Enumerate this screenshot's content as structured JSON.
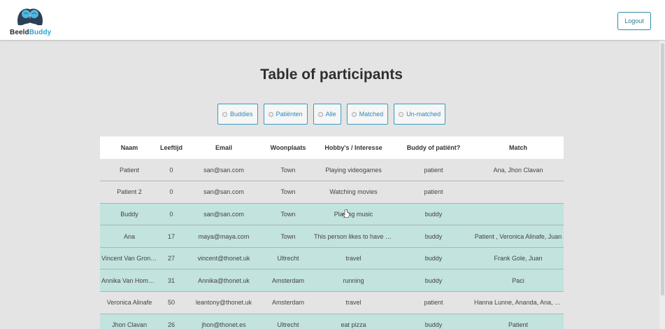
{
  "header": {
    "brand_part1": "Beeld",
    "brand_part2": "Buddy",
    "logout_label": "Logout"
  },
  "main": {
    "title": "Table of participants",
    "filters": [
      {
        "label": "Buddies"
      },
      {
        "label": "Patiënten"
      },
      {
        "label": "Alle"
      },
      {
        "label": "Matched"
      },
      {
        "label": "Un-matched"
      }
    ]
  },
  "table": {
    "columns": [
      "Naam",
      "Leeftijd",
      "Email",
      "Woonplaats",
      "Hobby's / Interesse",
      "Buddy of patiënt?",
      "Match"
    ],
    "rows": [
      {
        "cells": [
          "Patient",
          "0",
          "san@san.com",
          "Town",
          "Playing videogames",
          "patient",
          "Ana, Jhon Clavan"
        ],
        "type": "patient"
      },
      {
        "cells": [
          "Patient 2",
          "0",
          "san@san.com",
          "Town",
          "Watching movies",
          "patient",
          ""
        ],
        "type": "patient"
      },
      {
        "cells": [
          "Buddy",
          "0",
          "san@san.com",
          "Town",
          "Playing music",
          "buddy",
          ""
        ],
        "type": "buddy"
      },
      {
        "cells": [
          "Ana",
          "17",
          "maya@maya.com",
          "Town",
          "This person likes to have a...",
          "buddy",
          "Patient , Veronica Alinafe, Juan"
        ],
        "type": "buddy"
      },
      {
        "cells": [
          "Vincent Van Grond...",
          "27",
          "vincent@thonet.uk",
          "Ultrecht",
          "travel",
          "buddy",
          "Frank Gole, Juan"
        ],
        "type": "buddy"
      },
      {
        "cells": [
          "Annika Van Hommel",
          "31",
          "Annika@thonet.uk",
          "Amsterdam",
          "running",
          "buddy",
          "Paci"
        ],
        "type": "buddy"
      },
      {
        "cells": [
          "Veronica Alinafe",
          "50",
          "leantony@thonet.uk",
          "Amsterdam",
          "travel",
          "patient",
          "Hanna Lunne, Ananda, Ana, D..."
        ],
        "type": "patient"
      },
      {
        "cells": [
          "Jhon Clavan",
          "26",
          "jhon@thonet.es",
          "Ultrecht",
          "eat pizza",
          "buddy",
          "Patient"
        ],
        "type": "buddy"
      }
    ]
  }
}
